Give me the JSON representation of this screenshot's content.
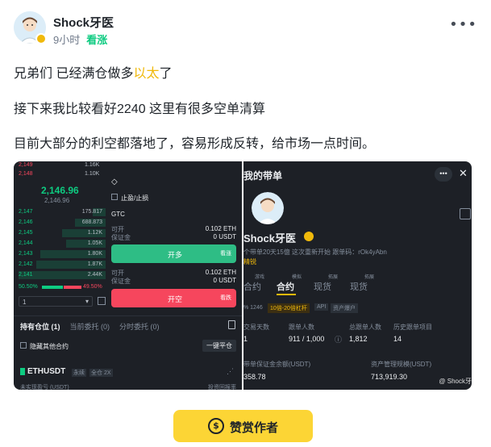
{
  "post": {
    "author": "Shock牙医",
    "time": "9小时",
    "sentiment": "看涨",
    "more": "•••",
    "line1_before": "兄弟们 已经满仓做多",
    "line1_highlight": "以太",
    "line1_after": "了",
    "line2": "接下来我比较看好2240 这里有很多空单清算",
    "line3": "目前大部分的利空都落地了，容易形成反转，给市场一点时间。"
  },
  "left_screenshot": {
    "asks": [
      {
        "price": "2,149",
        "qty": "1.16K"
      },
      {
        "price": "2,148",
        "qty": "1.10K"
      }
    ],
    "last_price": "2,146.96",
    "mark_price": "2,146.96",
    "bids": [
      {
        "price": "2,147",
        "qty": "175.817",
        "depth": 0.15
      },
      {
        "price": "2,146",
        "qty": "688.873",
        "depth": 0.35
      },
      {
        "price": "2,145",
        "qty": "1.12K",
        "depth": 0.5
      },
      {
        "price": "2,144",
        "qty": "1.05K",
        "depth": 0.45
      },
      {
        "price": "2,143",
        "qty": "1.80K",
        "depth": 0.75
      },
      {
        "price": "2,142",
        "qty": "1.87K",
        "depth": 0.8
      },
      {
        "price": "2,141",
        "qty": "2.44K",
        "depth": 1.0
      }
    ],
    "ratio_buy": "50.50%",
    "ratio_sell": "49.50%",
    "depth_select": "1",
    "stop_label": "止盈/止损",
    "tif": "GTC",
    "available_label": "可开",
    "available_value": "0.102 ETH",
    "margin_label": "保证金",
    "margin_value": "0 USDT",
    "available_label_2": "可开",
    "available_value_2": "0.102 ETH",
    "margin_label_2": "保证金",
    "margin_value_2": "0 USDT",
    "buy_label": "开多",
    "buy_tag": "看涨",
    "sell_label": "开空",
    "sell_tag": "看跌",
    "tabs": [
      "持有仓位 (1)",
      "当前委托 (0)",
      "分时委托 (0)"
    ],
    "hide_other": "隐藏其他合约",
    "close_all": "一键平仓",
    "symbol": "ETHUSDT",
    "symbol_tag1": "永续",
    "symbol_tag2": "全仓 2X",
    "pnl_label": "未实现盈亏 (USDT)",
    "roe_label": "投资回报率"
  },
  "right_screenshot": {
    "title": "我的带单",
    "name": "Shock牙医",
    "desc": "个带单20天15億 这次重新开始 跟单码：rOk4yAbn",
    "desc2": "精锐",
    "tabs": [
      "合约",
      "合约",
      "现货",
      "现货"
    ],
    "tab_tags": [
      "游戏",
      "模拟",
      "拓展",
      "拓展"
    ],
    "stat_tags": [
      "% 1246",
      "10倍-20倍杠杆",
      "API",
      "资产爆户"
    ],
    "row1_labels": [
      "交易天数",
      "跟单人数",
      "总跟单人数",
      "历史跟单项目"
    ],
    "row1_values": [
      "1",
      "911 / 1,000",
      "1,812",
      "14"
    ],
    "row2_label_left": "带单保证金余额(USDT)",
    "row2_label_right": "资产管理规模(USDT)",
    "row2_value_left": "358.78",
    "row2_value_right": "713,919.30",
    "watermark": "@ Shock牙"
  },
  "tip_button": {
    "label": "赞赏作者",
    "icon": "$"
  },
  "colors": {
    "accent": "#f0b90b",
    "bullish": "#0ecb81",
    "bearish": "#f6465d",
    "tip": "#fcd535"
  }
}
